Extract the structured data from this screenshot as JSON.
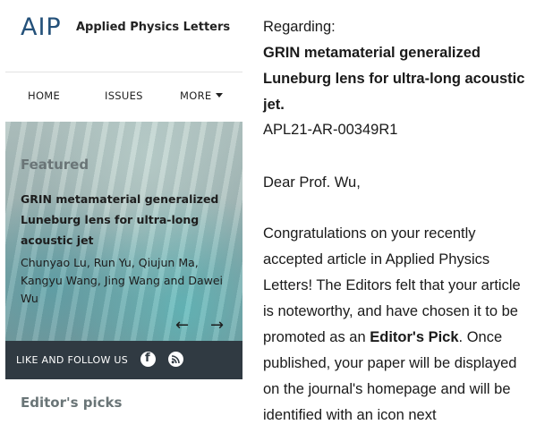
{
  "journal": {
    "logo": "AIP",
    "name": "Applied Physics Letters"
  },
  "nav": {
    "home": "HOME",
    "issues": "ISSUES",
    "more": "MORE"
  },
  "featured": {
    "label": "Featured",
    "title": "GRIN metamaterial generalized Luneburg lens for ultra-long acoustic jet",
    "authors": "Chunyao Lu, Run Yu, Qiujun Ma, Kangyu Wang, Jing Wang and Dawei Wu",
    "prev_icon": "arrow-left-icon",
    "next_icon": "arrow-right-icon",
    "prev_glyph": "←",
    "next_glyph": "→"
  },
  "follow": {
    "label": "LIKE AND FOLLOW US",
    "facebook_glyph": "f",
    "icons": [
      "facebook-icon",
      "rss-icon"
    ]
  },
  "editors_picks": "Editor's picks",
  "letter": {
    "regarding": "Regarding:",
    "title": "GRIN metamaterial generalized Luneburg lens for ultra-long acoustic jet.",
    "manuscript_id": "APL21-AR-00349R1",
    "salutation": "Dear Prof. Wu,",
    "body_before": "Congratulations on your recently accepted article in Applied Physics Letters! The Editors felt that your article is noteworthy, and have chosen it to be promoted as an ",
    "body_emphasis": "Editor's Pick",
    "body_after": ". Once published, your paper will be displayed on the journal's homepage and will be identified with an icon next"
  },
  "colors": {
    "logo": "#24517a",
    "follow_bar": "#303a42",
    "muted_heading": "#6a7577"
  }
}
